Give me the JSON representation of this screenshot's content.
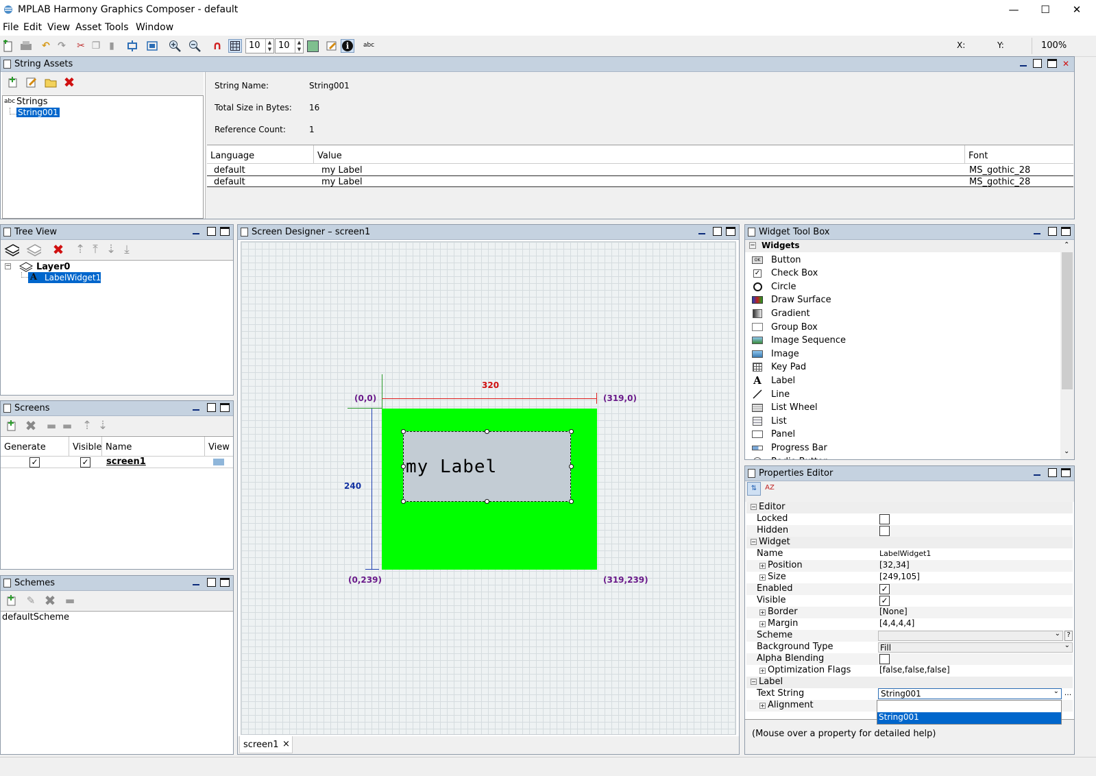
{
  "window": {
    "title": "MPLAB Harmony Graphics Composer - default",
    "minimize": "—",
    "maximize": "☐",
    "close": "✕"
  },
  "menu": [
    "File",
    "Edit",
    "View",
    "Asset",
    "Tools",
    "Window"
  ],
  "toolbar": {
    "grid_x": "10",
    "grid_y": "10",
    "abc_label": "abc",
    "x_label": "X:",
    "y_label": "Y:",
    "zoom": "100%"
  },
  "string_assets": {
    "title": "String Assets",
    "tree_root": "Strings",
    "tree_root_icon": "abc",
    "tree_item": "String001",
    "fields": {
      "name_label": "String Name:",
      "name_value": "String001",
      "size_label": "Total Size in Bytes:",
      "size_value": "16",
      "ref_label": "Reference Count:",
      "ref_value": "1"
    },
    "columns": [
      "Language",
      "Value",
      "Font"
    ],
    "rows": [
      [
        "default",
        "my Label",
        "MS_gothic_28"
      ],
      [
        "default",
        "my Label",
        "MS_gothic_28"
      ]
    ]
  },
  "tree_view": {
    "title": "Tree View",
    "layer": "Layer0",
    "widget": "LabelWidget1"
  },
  "screens": {
    "title": "Screens",
    "columns": [
      "Generate",
      "Visible",
      "Name",
      "View"
    ],
    "row_name": "screen1"
  },
  "schemes": {
    "title": "Schemes",
    "item": "defaultScheme"
  },
  "designer": {
    "title": "Screen Designer – screen1",
    "tab": "screen1",
    "tab_close": "×",
    "label_text": "my Label",
    "width_label": "320",
    "height_label": "240",
    "corner_tl": "(0,0)",
    "corner_tr": "(319,0)",
    "corner_bl": "(0,239)",
    "corner_br": "(319,239)",
    "screen_color": "#00ff00",
    "label_color": "#c3ccd4"
  },
  "widget_toolbox": {
    "title": "Widget Tool Box",
    "group": "Widgets",
    "items": [
      {
        "label": "Button",
        "icon": "button-icon"
      },
      {
        "label": "Check Box",
        "icon": "checkbox-icon"
      },
      {
        "label": "Circle",
        "icon": "circle-icon"
      },
      {
        "label": "Draw Surface",
        "icon": "draw-surface-icon"
      },
      {
        "label": "Gradient",
        "icon": "gradient-icon"
      },
      {
        "label": "Group Box",
        "icon": "group-box-icon"
      },
      {
        "label": "Image Sequence",
        "icon": "image-sequence-icon"
      },
      {
        "label": "Image",
        "icon": "image-icon"
      },
      {
        "label": "Key Pad",
        "icon": "keypad-icon"
      },
      {
        "label": "Label",
        "icon": "label-icon"
      },
      {
        "label": "Line",
        "icon": "line-icon"
      },
      {
        "label": "List Wheel",
        "icon": "list-wheel-icon"
      },
      {
        "label": "List",
        "icon": "list-icon"
      },
      {
        "label": "Panel",
        "icon": "panel-icon"
      },
      {
        "label": "Progress Bar",
        "icon": "progress-bar-icon"
      },
      {
        "label": "Radio Button",
        "icon": "radio-button-icon"
      }
    ]
  },
  "properties": {
    "title": "Properties Editor",
    "help": "(Mouse over a property for detailed help)",
    "sections": {
      "editor": "Editor",
      "widget": "Widget",
      "label": "Label"
    },
    "rows": {
      "locked": "Locked",
      "hidden": "Hidden",
      "name": "Name",
      "name_value": "LabelWidget1",
      "position": "Position",
      "position_value": "[32,34]",
      "size": "Size",
      "size_value": "[249,105]",
      "enabled": "Enabled",
      "visible": "Visible",
      "border": "Border",
      "border_value": "[None]",
      "margin": "Margin",
      "margin_value": "[4,4,4,4]",
      "scheme": "Scheme",
      "scheme_help": "?",
      "bg_type": "Background Type",
      "bg_type_value": "Fill",
      "alpha": "Alpha Blending",
      "opt_flags": "Optimization Flags",
      "opt_flags_value": "[false,false,false]",
      "text_string": "Text String",
      "text_string_value": "String001",
      "text_string_more": "...",
      "alignment": "Alignment"
    },
    "dropdown_options": [
      "",
      "String001"
    ]
  }
}
